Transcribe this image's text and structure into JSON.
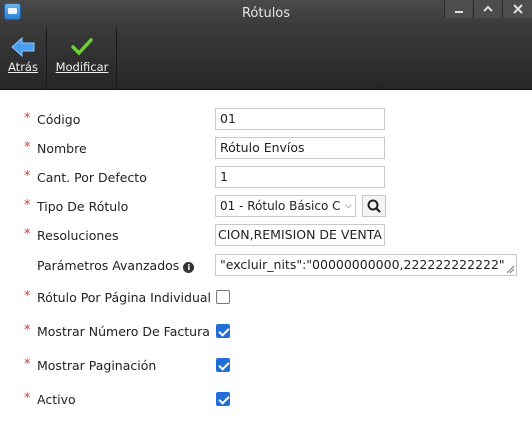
{
  "window": {
    "title": "Rótulos",
    "minimize_icon": "minimize-icon",
    "maximize_icon": "chevron-up-icon",
    "close_icon": "close-icon"
  },
  "toolbar": {
    "back_label": "Atrás",
    "modify_label": "Modificar"
  },
  "form": {
    "codigo": {
      "label": "Código",
      "value": "01"
    },
    "nombre": {
      "label": "Nombre",
      "value": "Rótulo Envíos"
    },
    "cant_defecto": {
      "label": "Cant. Por Defecto",
      "value": "1"
    },
    "tipo_rotulo": {
      "label": "Tipo De Rótulo",
      "value": "01 - Rótulo Básico C"
    },
    "resoluciones": {
      "label": "Resoluciones",
      "value": "CION,REMISION DE VENTA"
    },
    "parametros": {
      "label": "Parámetros Avanzados",
      "value": "\"excluir_nits\":\"00000000000,222222222222\""
    },
    "rotulo_pagina": {
      "label": "Rótulo Por Página Individual",
      "checked": false
    },
    "mostrar_factura": {
      "label": "Mostrar Número De Factura",
      "checked": true
    },
    "mostrar_paginacion": {
      "label": "Mostrar Paginación",
      "checked": true
    },
    "activo": {
      "label": "Activo",
      "checked": true
    }
  },
  "colors": {
    "accent": "#1f6fd6",
    "required": "#d23a3a",
    "toolbar": "#2f2f2f"
  }
}
